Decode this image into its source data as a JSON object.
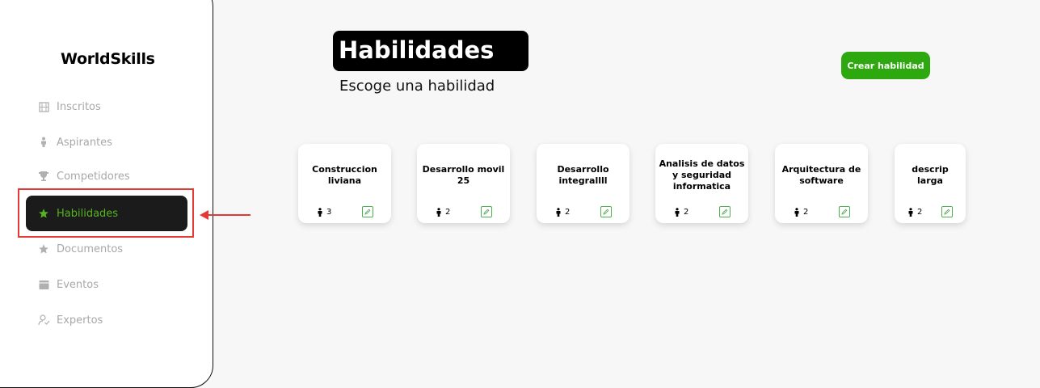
{
  "brand": "WorldSkills",
  "accent_color": "#2ea80f",
  "sidebar": {
    "items": [
      {
        "label": "Inscritos",
        "icon": "grid-icon",
        "active": false
      },
      {
        "label": "Aspirantes",
        "icon": "person-icon",
        "active": false
      },
      {
        "label": "Competidores",
        "icon": "trophy-icon",
        "active": false
      },
      {
        "label": "Habilidades",
        "icon": "star-icon",
        "active": true
      },
      {
        "label": "Documentos",
        "icon": "star-icon",
        "active": false
      },
      {
        "label": "Eventos",
        "icon": "calendar-icon",
        "active": false
      },
      {
        "label": "Expertos",
        "icon": "user-check-icon",
        "active": false
      }
    ]
  },
  "main": {
    "title": "Habilidades",
    "subtitle": "Escoge una habilidad",
    "create_button": "Crear habilidad"
  },
  "skills": [
    {
      "name": "Construccion liviana",
      "count": "3"
    },
    {
      "name": "Desarrollo movil 25",
      "count": "2"
    },
    {
      "name": "Desarrollo integrallll",
      "count": "2"
    },
    {
      "name": "Analisis de datos y seguridad informatica",
      "count": "2"
    },
    {
      "name": "Arquitectura de software",
      "count": "2"
    },
    {
      "name": "descrip larga",
      "count": "2"
    }
  ]
}
